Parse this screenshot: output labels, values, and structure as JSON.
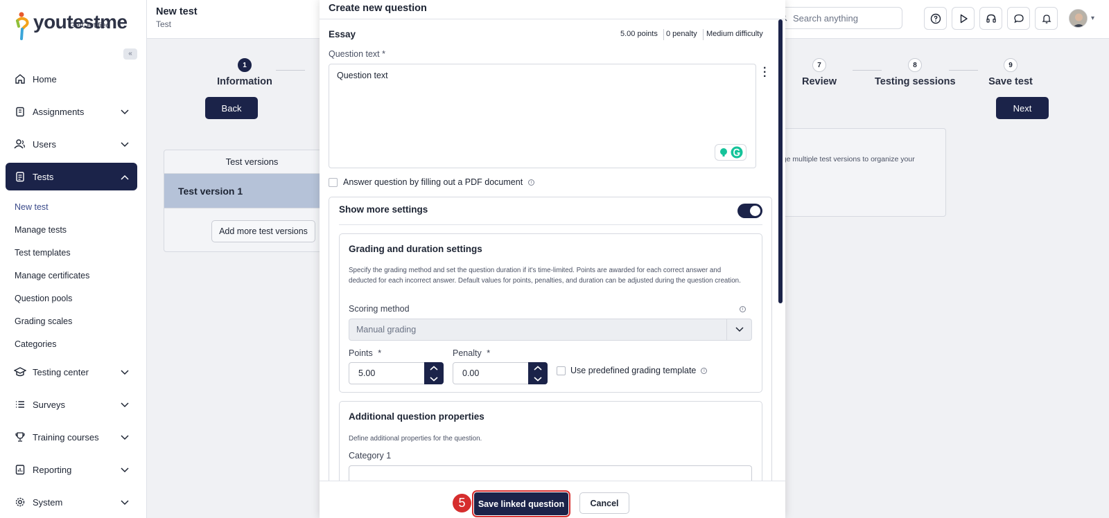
{
  "app": {
    "logo_text": "youtestme",
    "logo_sub": "GetCertified"
  },
  "sidebar": {
    "collapse_label": "«",
    "items": [
      {
        "label": "Home",
        "icon": "home-icon"
      },
      {
        "label": "Assignments",
        "icon": "clipboard-icon"
      },
      {
        "label": "Users",
        "icon": "users-icon"
      },
      {
        "label": "Tests",
        "icon": "document-icon",
        "active": true
      },
      {
        "label": "Testing center",
        "icon": "graduation-cap-icon"
      },
      {
        "label": "Surveys",
        "icon": "list-icon"
      },
      {
        "label": "Training courses",
        "icon": "trophy-icon"
      },
      {
        "label": "Reporting",
        "icon": "report-icon"
      },
      {
        "label": "System",
        "icon": "gear-icon"
      }
    ],
    "sub_items": [
      "New test",
      "Manage tests",
      "Test templates",
      "Manage certificates",
      "Question pools",
      "Grading scales",
      "Categories"
    ]
  },
  "header": {
    "title": "New test",
    "subtitle": "Test",
    "search_placeholder": "Search anything"
  },
  "wizard": {
    "steps": [
      {
        "num": "1",
        "label": "Information"
      },
      {
        "num": "7",
        "label": "Review"
      },
      {
        "num": "8",
        "label": "Testing sessions"
      },
      {
        "num": "9",
        "label": "Save test"
      }
    ],
    "back_label": "Back",
    "next_label": "Next"
  },
  "test_versions": {
    "header": "Test versions",
    "row": "Test version 1",
    "add_label": "Add more test versions",
    "right_text": "age multiple test versions to organize your"
  },
  "modal": {
    "title": "Create new question",
    "question_type": "Essay",
    "points_meta": "5.00 points",
    "penalty_meta": "0 penalty",
    "difficulty_meta": "Medium difficulty",
    "question_text_label": "Question text *",
    "question_text_value": "Question text",
    "pdf_option": "Answer question by filling out a PDF document",
    "more_settings": "Show more settings",
    "grading": {
      "title": "Grading and duration settings",
      "description": "Specify the grading method and set the question duration if it's time-limited. Points are awarded for each correct answer and deducted for each incorrect answer. Default values for points, penalties, and duration can be adjusted during the question creation.",
      "scoring_label": "Scoring method",
      "scoring_value": "Manual grading",
      "points_label": "Points",
      "points_value": "5.00",
      "penalty_label": "Penalty",
      "penalty_value": "0.00",
      "required_mark": "*",
      "template_label": "Use predefined grading template"
    },
    "additional": {
      "title": "Additional question properties",
      "description": "Define additional properties for the question.",
      "category_label": "Category 1"
    },
    "save_label": "Save linked question",
    "cancel_label": "Cancel",
    "step_badge": "5"
  },
  "colors": {
    "primary": "#1b2349",
    "accent_red": "#d62d2d"
  }
}
